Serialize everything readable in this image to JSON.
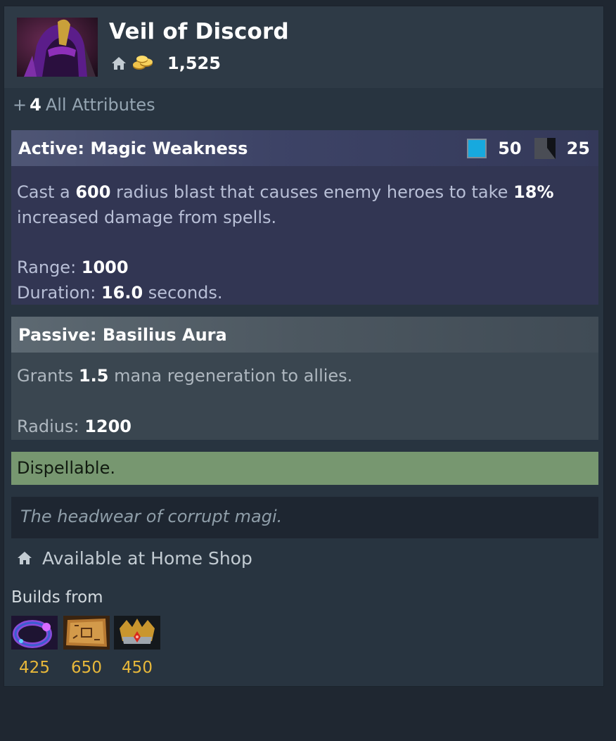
{
  "item": {
    "name": "Veil of Discord",
    "icon": "veil-of-discord-icon",
    "cost": "1,525"
  },
  "bonus": {
    "plus": "+",
    "value": "4",
    "label": "All Attributes"
  },
  "active": {
    "title": "Active: Magic Weakness",
    "mana_cost": "50",
    "cooldown": "25",
    "text_1": "Cast a ",
    "radius": "600",
    "text_2": " radius blast that causes enemy heroes to take ",
    "percent": "18%",
    "text_3": "increased damage from spells.",
    "range_label": "Range: ",
    "range_value": "1000",
    "duration_label": "Duration: ",
    "duration_value": "16.0",
    "duration_unit": " seconds."
  },
  "passive": {
    "title": "Passive: Basilius Aura",
    "text_1": "Grants ",
    "regen": "1.5",
    "text_2": " mana regeneration to allies.",
    "radius_label": "Radius: ",
    "radius_value": "1200"
  },
  "dispel": "Dispellable.",
  "lore": "The headwear of corrupt magi.",
  "shop": "Available at Home Shop",
  "builds_from": {
    "label": "Builds from",
    "components": [
      {
        "icon": "ring-icon",
        "cost": "425"
      },
      {
        "icon": "recipe-scroll-icon",
        "cost": "650"
      },
      {
        "icon": "crown-icon",
        "cost": "450"
      }
    ]
  },
  "colors": {
    "mana": "#17a9de",
    "gold": "#e8b83a",
    "dispel_bg": "#779770",
    "active_bg": "#323653"
  }
}
